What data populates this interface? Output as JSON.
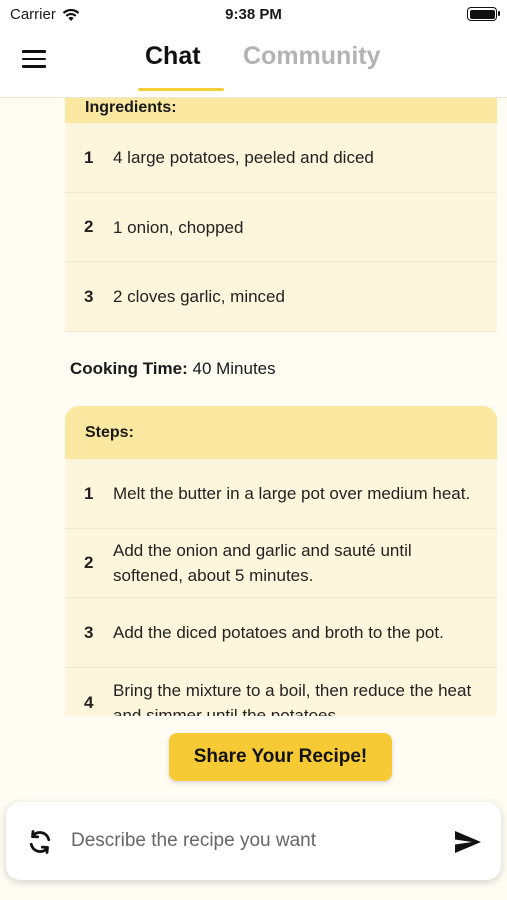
{
  "status": {
    "carrier": "Carrier",
    "time": "9:38 PM"
  },
  "header": {
    "tabs": [
      {
        "label": "Chat"
      },
      {
        "label": "Community"
      }
    ]
  },
  "recipe": {
    "ingredients_heading": "Ingredients:",
    "ingredients": [
      {
        "num": "1",
        "text": "4 large potatoes, peeled and diced"
      },
      {
        "num": "2",
        "text": "1 onion, chopped"
      },
      {
        "num": "3",
        "text": "2 cloves garlic, minced"
      }
    ],
    "cooking_time_label": "Cooking Time:",
    "cooking_time_value": "40 Minutes",
    "steps_heading": "Steps:",
    "steps": [
      {
        "num": "1",
        "text": "Melt the butter in a large pot over medium heat."
      },
      {
        "num": "2",
        "text": "Add the onion and garlic and sauté until softened, about 5 minutes."
      },
      {
        "num": "3",
        "text": "Add the diced potatoes and broth to the pot."
      },
      {
        "num": "4",
        "text": "Bring the mixture to a boil, then reduce the heat and simmer until the potatoes"
      }
    ]
  },
  "share_button": {
    "label": "Share Your Recipe!"
  },
  "composer": {
    "placeholder": "Describe the recipe you want"
  }
}
